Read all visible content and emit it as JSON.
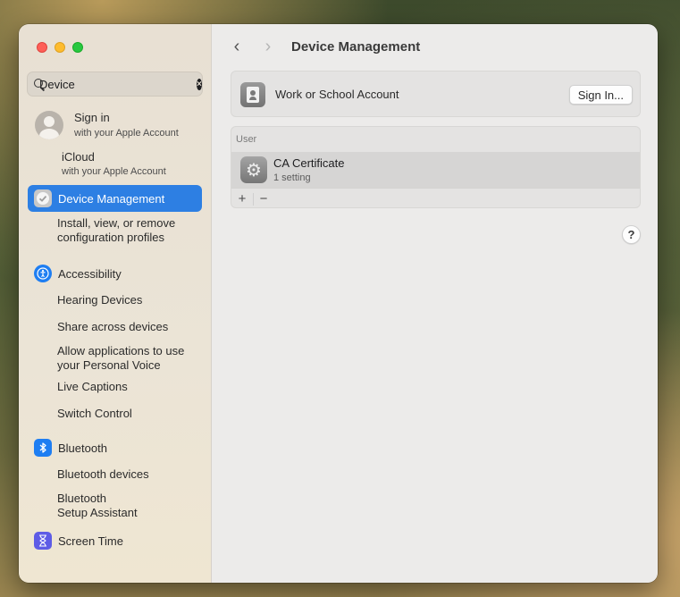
{
  "sidebar": {
    "search": {
      "value": "Device",
      "placeholder": "Search"
    },
    "account": {
      "title": "Sign in",
      "subtitle": "with your Apple Account"
    },
    "icloud": {
      "title": "iCloud",
      "subtitle": "with your Apple Account"
    },
    "device_management": {
      "label_prefix": "Device",
      "label_suffix": " Management",
      "subs": [
        "Install, view, or remove",
        "configuration profiles"
      ]
    },
    "accessibility": {
      "label": "Accessibility",
      "items": [
        {
          "lines": [
            "Hearing Devices"
          ]
        },
        {
          "lines": [
            "Share across devices"
          ]
        },
        {
          "lines": [
            "Allow applications to use",
            "your Personal Voice"
          ]
        },
        {
          "lines": [
            "Live Captions"
          ]
        },
        {
          "lines": [
            "Switch Control"
          ]
        }
      ]
    },
    "bluetooth": {
      "label": "Bluetooth",
      "items": [
        {
          "lines": [
            "Bluetooth devices"
          ]
        },
        {
          "lines": [
            "Bluetooth",
            "Setup Assistant"
          ]
        }
      ]
    },
    "screen_time": {
      "label": "Screen Time"
    }
  },
  "main": {
    "title": "Device Management",
    "work_account": {
      "label": "Work or School Account",
      "button": "Sign In..."
    },
    "profiles": {
      "section_header": "User",
      "rows": [
        {
          "title": "CA Certificate",
          "subtitle": "1 setting"
        }
      ],
      "add": "+",
      "remove": "−"
    },
    "help": "?"
  },
  "colors": {
    "accent": "#2d7fe3",
    "accessibility_icon": "#1e7ef2",
    "bluetooth_icon": "#1e7ef2",
    "screen_time_icon": "#5e5ce6",
    "traffic_close": "#fe5f57",
    "traffic_min": "#febc2e",
    "traffic_max": "#28c840"
  }
}
